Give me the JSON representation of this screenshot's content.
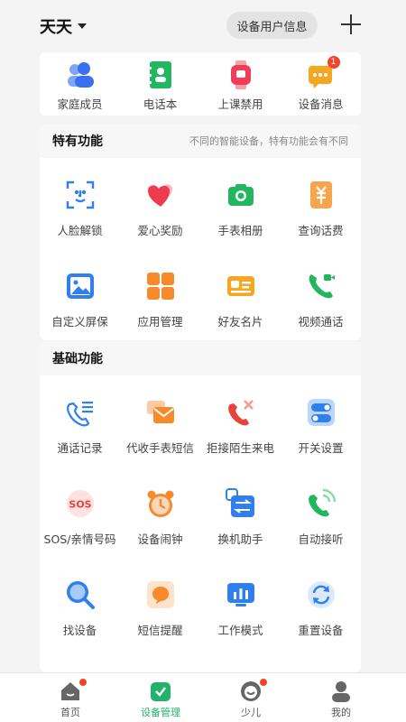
{
  "header": {
    "device_name": "天天",
    "user_info_button": "设备用户信息"
  },
  "top_shortcuts": [
    {
      "label": "家庭成员",
      "icon": "family-members-icon"
    },
    {
      "label": "电话本",
      "icon": "phonebook-icon"
    },
    {
      "label": "上课禁用",
      "icon": "class-disable-icon"
    },
    {
      "label": "设备消息",
      "icon": "device-message-icon",
      "badge": "1"
    }
  ],
  "special": {
    "title": "特有功能",
    "note": "不同的智能设备，特有功能会有不同",
    "items": [
      {
        "label": "人脸解锁",
        "icon": "face-unlock-icon"
      },
      {
        "label": "爱心奖励",
        "icon": "heart-reward-icon"
      },
      {
        "label": "手表相册",
        "icon": "camera-icon"
      },
      {
        "label": "查询话费",
        "icon": "bill-query-icon"
      },
      {
        "label": "自定义屏保",
        "icon": "screensaver-icon"
      },
      {
        "label": "应用管理",
        "icon": "app-manage-icon"
      },
      {
        "label": "好友名片",
        "icon": "friend-card-icon"
      },
      {
        "label": "视频通话",
        "icon": "video-call-icon"
      }
    ]
  },
  "basic": {
    "title": "基础功能",
    "items": [
      {
        "label": "通话记录",
        "icon": "call-log-icon"
      },
      {
        "label": "代收手表短信",
        "icon": "sms-collect-icon"
      },
      {
        "label": "拒接陌生来电",
        "icon": "reject-call-icon"
      },
      {
        "label": "开关设置",
        "icon": "switch-settings-icon"
      },
      {
        "label": "SOS/亲情号码",
        "icon": "sos-icon"
      },
      {
        "label": "设备闹钟",
        "icon": "alarm-icon"
      },
      {
        "label": "换机助手",
        "icon": "switch-device-icon"
      },
      {
        "label": "自动接听",
        "icon": "auto-answer-icon"
      },
      {
        "label": "找设备",
        "icon": "find-device-icon"
      },
      {
        "label": "短信提醒",
        "icon": "sms-remind-icon"
      },
      {
        "label": "工作模式",
        "icon": "work-mode-icon"
      },
      {
        "label": "重置设备",
        "icon": "reset-device-icon"
      }
    ]
  },
  "tabbar": [
    {
      "label": "首页",
      "icon": "home-icon",
      "active": false,
      "dot": true
    },
    {
      "label": "设备管理",
      "icon": "device-manage-icon",
      "active": true,
      "dot": false
    },
    {
      "label": "少儿",
      "icon": "kids-icon",
      "active": false,
      "dot": true
    },
    {
      "label": "我的",
      "icon": "profile-icon",
      "active": false,
      "dot": false
    }
  ],
  "colors": {
    "accent_green": "#21b36b",
    "badge_red": "#f0472c"
  }
}
